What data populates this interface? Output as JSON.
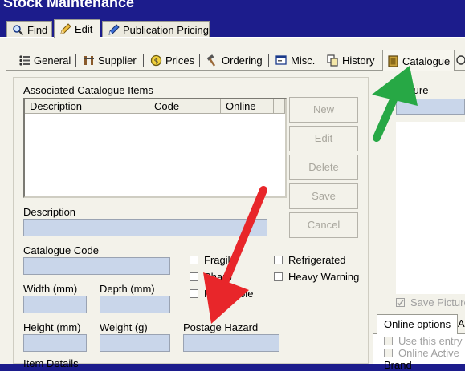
{
  "window": {
    "title": "Stock Maintenance"
  },
  "top_tabs": [
    {
      "label": "Find",
      "icon": "magnifier-icon"
    },
    {
      "label": "Edit",
      "icon": "pencil-icon",
      "active": true
    },
    {
      "label": "Publication Pricing",
      "icon": "blue-pencil-icon"
    }
  ],
  "sub_tabs": [
    {
      "label": "General",
      "icon": "list-icon"
    },
    {
      "label": "Supplier",
      "icon": "hanger-icon"
    },
    {
      "label": "Prices",
      "icon": "coin-icon"
    },
    {
      "label": "Ordering",
      "icon": "hammer-icon"
    },
    {
      "label": "Misc.",
      "icon": "window-icon"
    },
    {
      "label": "History",
      "icon": "copy-icon"
    },
    {
      "label": "Catalogue",
      "icon": "catalogue-icon",
      "active": true
    }
  ],
  "catalogue": {
    "associated_label": "Associated Catalogue Items",
    "columns": [
      "Description",
      "Code",
      "Online"
    ],
    "rows": [],
    "buttons": {
      "new": "New",
      "edit": "Edit",
      "delete": "Delete",
      "save": "Save",
      "cancel": "Cancel"
    },
    "description_label": "Description",
    "description_value": "",
    "catalogue_code_label": "Catalogue Code",
    "catalogue_code_value": "",
    "width_label": "Width (mm)",
    "depth_label": "Depth (mm)",
    "height_label": "Height (mm)",
    "weight_label": "Weight (g)",
    "postage_hazard_label": "Postage Hazard",
    "item_details_label": "Item Details",
    "checkboxes": {
      "fragile": "Fragile",
      "sharp": "Sharp",
      "perishable": "Perishable",
      "refrigerated": "Refrigerated",
      "heavy_warning": "Heavy Warning"
    }
  },
  "right_panel": {
    "picture_label": "Picture",
    "save_picture_label": "Save Picture",
    "online_options_tab": "Online options",
    "other_tab": "A",
    "use_entry_label": "Use this entry t",
    "online_active_label": "Online Active",
    "brand_label": "Brand"
  },
  "colors": {
    "title_bar": "#1c1c8c",
    "field_fill": "#c9d6ea",
    "annotation_red": "#e8262a",
    "annotation_green": "#27a845"
  }
}
